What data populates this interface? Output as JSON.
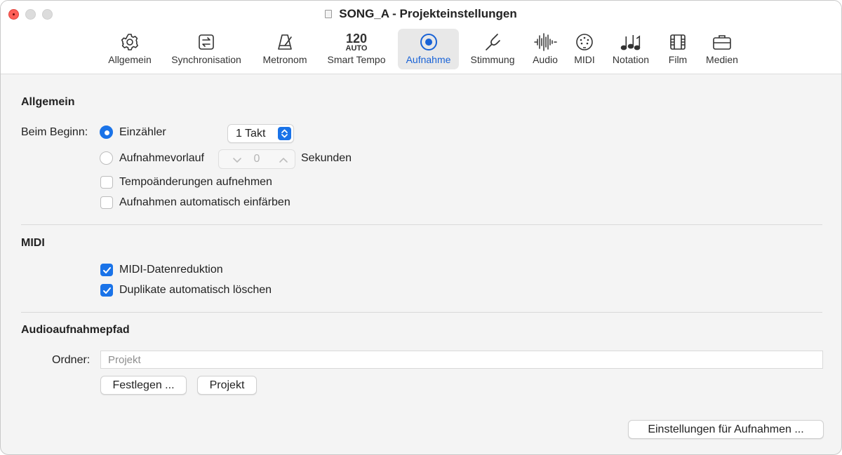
{
  "window": {
    "title": "SONG_A - Projekteinstellungen"
  },
  "toolbar": {
    "tabs": [
      {
        "label": "Allgemein",
        "icon": "gear-icon"
      },
      {
        "label": "Synchronisation",
        "icon": "sync-icon"
      },
      {
        "label": "Metronom",
        "icon": "metronome-icon"
      },
      {
        "label": "Smart Tempo",
        "icon": "tempo-icon",
        "icon_text_1": "120",
        "icon_text_2": "AUTO"
      },
      {
        "label": "Aufnahme",
        "icon": "record-icon",
        "active": true
      },
      {
        "label": "Stimmung",
        "icon": "tuning-fork-icon"
      },
      {
        "label": "Audio",
        "icon": "waveform-icon"
      },
      {
        "label": "MIDI",
        "icon": "midi-port-icon"
      },
      {
        "label": "Notation",
        "icon": "notes-icon"
      },
      {
        "label": "Film",
        "icon": "film-icon"
      },
      {
        "label": "Medien",
        "icon": "briefcase-icon"
      }
    ]
  },
  "general": {
    "title": "Allgemein",
    "start_label": "Beim Beginn:",
    "count_in": {
      "label": "Einzähler",
      "selected": true
    },
    "bars_popup": {
      "value": "1 Takt"
    },
    "pre_roll": {
      "label": "Aufnahmevorlauf",
      "selected": false
    },
    "pre_roll_value": "0",
    "seconds_label": "Sekunden",
    "tempo_changes": {
      "label": "Tempoänderungen aufnehmen",
      "checked": false
    },
    "auto_color": {
      "label": "Aufnahmen automatisch einfärben",
      "checked": false
    }
  },
  "midi": {
    "title": "MIDI",
    "data_reduction": {
      "label": "MIDI-Datenreduktion",
      "checked": true
    },
    "auto_delete_duplicates": {
      "label": "Duplikate automatisch löschen",
      "checked": true
    }
  },
  "audio_path": {
    "title": "Audioaufnahmepfad",
    "folder_label": "Ordner:",
    "folder_placeholder": "Projekt",
    "set_button": "Festlegen ...",
    "project_button": "Projekt"
  },
  "footer": {
    "recording_settings_button": "Einstellungen für Aufnahmen ..."
  },
  "colors": {
    "accent": "#1a73e8",
    "active_tab": "#1862d6",
    "close": "#ff5f57"
  }
}
